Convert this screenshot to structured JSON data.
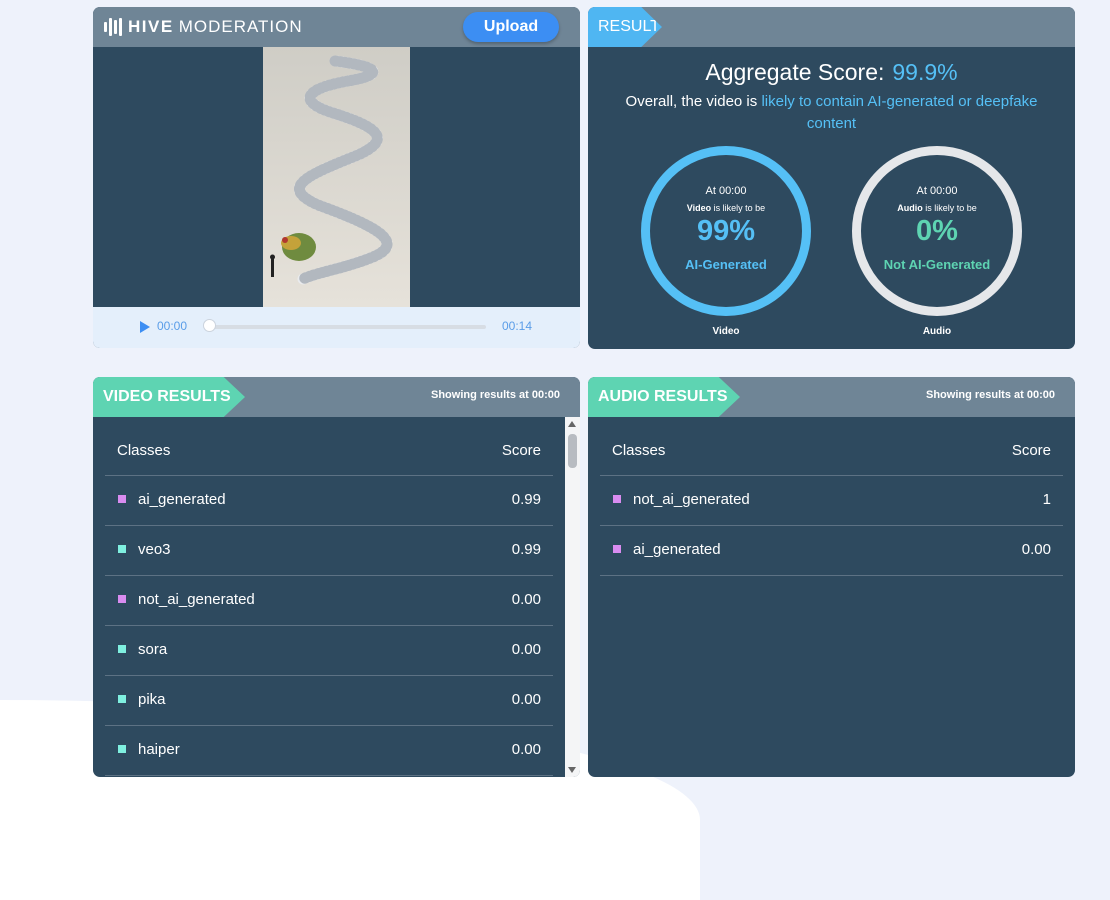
{
  "logo": {
    "strong": "HIVE",
    "light": "MODERATION"
  },
  "player": {
    "upload_label": "Upload",
    "current_time": "00:00",
    "duration": "00:14",
    "progress_fraction": 0
  },
  "result": {
    "tab": "RESULT",
    "aggregate_label": "Aggregate Score:",
    "aggregate_value": "99.9%",
    "overall_prefix": "Overall, the video is",
    "overall_link": "likely to contain AI-generated or deepfake content",
    "video_gauge": {
      "at": "At 00:00",
      "subject": "Video",
      "likely": "is likely to be",
      "percent": "99%",
      "label": "AI-Generated",
      "caption": "Video",
      "color": "#55c0f6"
    },
    "audio_gauge": {
      "at": "At 00:00",
      "subject": "Audio",
      "likely": "is likely to be",
      "percent": "0%",
      "label": "Not AI-Generated",
      "caption": "Audio",
      "color": "#5ed4b2"
    }
  },
  "video_results": {
    "tab": "VIDEO RESULTS",
    "showing_prefix": "Showing results at",
    "showing_time": "00:00",
    "col_classes": "Classes",
    "col_score": "Score",
    "rows": [
      {
        "name": "ai_generated",
        "score": "0.99",
        "color": "#d98cf0"
      },
      {
        "name": "veo3",
        "score": "0.99",
        "color": "#7ff0e0"
      },
      {
        "name": "not_ai_generated",
        "score": "0.00",
        "color": "#d98cf0"
      },
      {
        "name": "sora",
        "score": "0.00",
        "color": "#7ff0e0"
      },
      {
        "name": "pika",
        "score": "0.00",
        "color": "#7ff0e0"
      },
      {
        "name": "haiper",
        "score": "0.00",
        "color": "#7ff0e0"
      }
    ]
  },
  "audio_results": {
    "tab": "AUDIO RESULTS",
    "showing_prefix": "Showing results at",
    "showing_time": "00:00",
    "col_classes": "Classes",
    "col_score": "Score",
    "rows": [
      {
        "name": "not_ai_generated",
        "score": "1",
        "color": "#d98cf0"
      },
      {
        "name": "ai_generated",
        "score": "0.00",
        "color": "#d98cf0"
      }
    ]
  }
}
